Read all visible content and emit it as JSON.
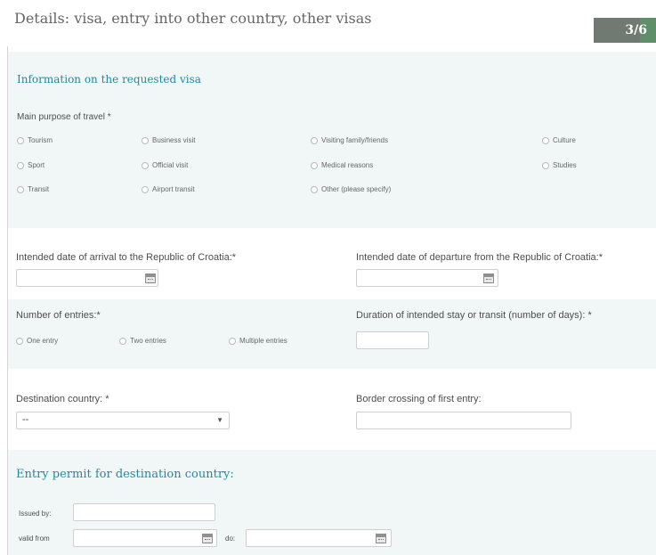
{
  "header": {
    "title": "Details: visa, entry into other country, other visas",
    "step": "3/6"
  },
  "visa_info": {
    "section_title": "Information on the requested visa",
    "purpose_label": "Main purpose of travel *",
    "purposes": [
      "Tourism",
      "Business visit",
      "Visiting family/friends",
      "Culture",
      "Sport",
      "Official visit",
      "Medical reasons",
      "Studies",
      "Transit",
      "Airport transit",
      "Other (please specify)"
    ]
  },
  "dates": {
    "arrival_label": "Intended date of arrival to the Republic of Croatia:*",
    "departure_label": "Intended date of departure from the Republic of Croatia:*"
  },
  "entries": {
    "label": "Number of entries:*",
    "options": [
      "One entry",
      "Two entries",
      "Multiple entries"
    ],
    "duration_label": "Duration of intended stay or transit (number of days): *"
  },
  "destination": {
    "country_label": "Destination country: *",
    "country_value": "--",
    "border_label": "Border crossing of first entry:"
  },
  "entry_permit": {
    "section_title": "Entry permit for destination country:",
    "issued_by_label": "Issued by:",
    "valid_from_label": "valid from",
    "to_label": "do:"
  },
  "icons": [
    "calendar-icon",
    "chevron-down-icon",
    "radio-icon"
  ]
}
